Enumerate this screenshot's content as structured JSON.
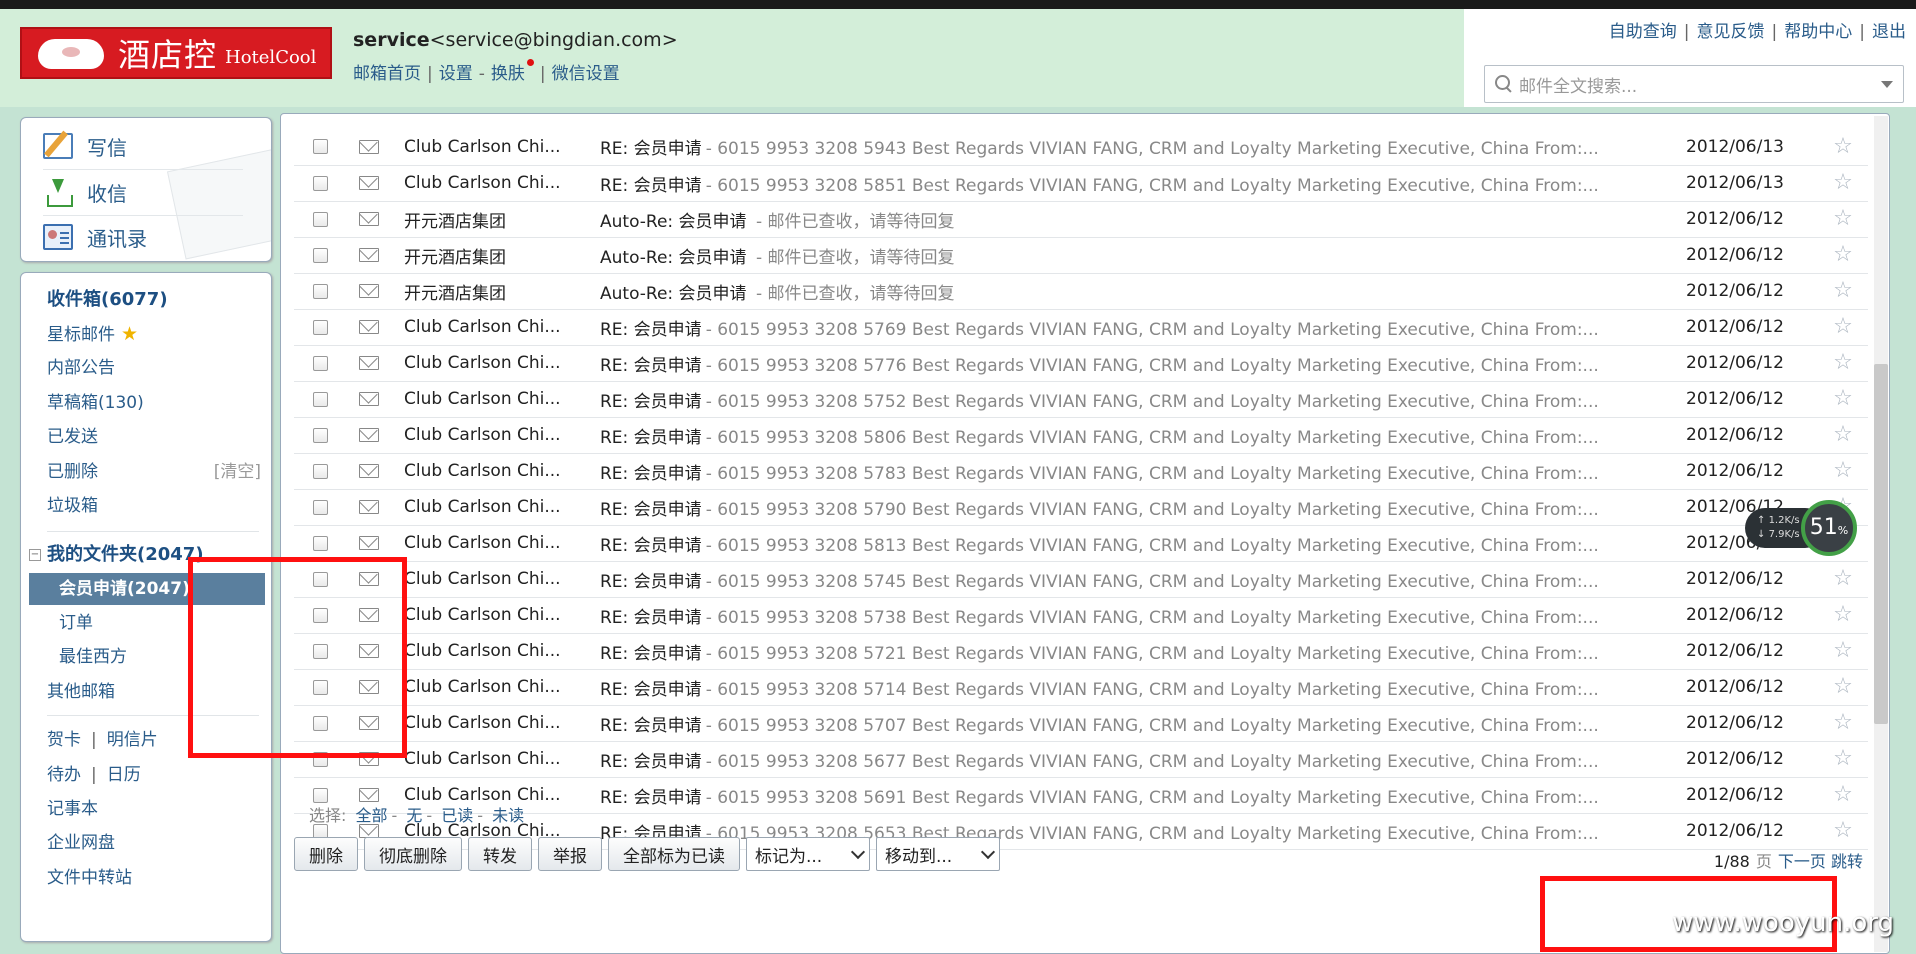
{
  "header": {
    "logo_cn": "酒店控",
    "logo_en": "HotelCool",
    "account_name": "service",
    "account_email": "<service@bingdian.com>",
    "links": [
      "邮箱首页",
      "设置",
      "换肤",
      "微信设置"
    ],
    "top_links": [
      "自助查询",
      "意见反馈",
      "帮助中心",
      "退出"
    ],
    "search_placeholder": "邮件全文搜索..."
  },
  "sidebar": {
    "quick": [
      "写信",
      "收信",
      "通讯录"
    ],
    "inbox": "收件箱(6077)",
    "starred": "星标邮件",
    "announce": "内部公告",
    "drafts": "草稿箱(130)",
    "sent": "已发送",
    "deleted": "已删除",
    "clear": "[清空]",
    "spam": "垃圾箱",
    "my_folders": "我的文件夹(2047)",
    "selected_folder": "会员申请(2047)",
    "subfolders": [
      "订单",
      "最佳西方"
    ],
    "other": "其他邮箱",
    "tools": [
      "贺卡",
      "明信片",
      "待办",
      "日历",
      "记事本",
      "企业网盘",
      "文件中转站"
    ]
  },
  "mails": [
    {
      "from": "Club Carlson Chi...",
      "subject": "RE: 会员申请",
      "summary": "- 6015 9953 3208 5943  Best Regards VIVIAN FANG, CRM and Loyalty Marketing Executive, China  From:...",
      "date": "2012/06/13"
    },
    {
      "from": "Club Carlson Chi...",
      "subject": "RE: 会员申请",
      "summary": "- 6015 9953 3208 5851  Best Regards VIVIAN FANG, CRM and Loyalty Marketing Executive, China  From:...",
      "date": "2012/06/13"
    },
    {
      "from": "开元酒店集团",
      "subject": "Auto-Re: 会员申请",
      "summary": " - 邮件已查收，请等待回复",
      "date": "2012/06/12"
    },
    {
      "from": "开元酒店集团",
      "subject": "Auto-Re: 会员申请",
      "summary": " - 邮件已查收，请等待回复",
      "date": "2012/06/12"
    },
    {
      "from": "开元酒店集团",
      "subject": "Auto-Re: 会员申请",
      "summary": " - 邮件已查收，请等待回复",
      "date": "2012/06/12"
    },
    {
      "from": "Club Carlson Chi...",
      "subject": "RE: 会员申请",
      "summary": "- 6015 9953 3208 5769  Best Regards VIVIAN FANG, CRM and Loyalty Marketing Executive, China  From:...",
      "date": "2012/06/12"
    },
    {
      "from": "Club Carlson Chi...",
      "subject": "RE: 会员申请",
      "summary": "- 6015 9953 3208 5776  Best Regards VIVIAN FANG, CRM and Loyalty Marketing Executive, China  From:...",
      "date": "2012/06/12"
    },
    {
      "from": "Club Carlson Chi...",
      "subject": "RE: 会员申请",
      "summary": "- 6015 9953 3208 5752  Best Regards VIVIAN FANG, CRM and Loyalty Marketing Executive, China  From:...",
      "date": "2012/06/12"
    },
    {
      "from": "Club Carlson Chi...",
      "subject": "RE: 会员申请",
      "summary": "- 6015 9953 3208 5806  Best Regards VIVIAN FANG, CRM and Loyalty Marketing Executive, China  From:...",
      "date": "2012/06/12"
    },
    {
      "from": "Club Carlson Chi...",
      "subject": "RE: 会员申请",
      "summary": "- 6015 9953 3208 5783  Best Regards VIVIAN FANG, CRM and Loyalty Marketing Executive, China  From:...",
      "date": "2012/06/12"
    },
    {
      "from": "Club Carlson Chi...",
      "subject": "RE: 会员申请",
      "summary": "- 6015 9953 3208 5790  Best Regards VIVIAN FANG, CRM and Loyalty Marketing Executive, China  From:...",
      "date": "2012/06/12"
    },
    {
      "from": "Club Carlson Chi...",
      "subject": "RE: 会员申请",
      "summary": "- 6015 9953 3208 5813  Best Regards VIVIAN FANG, CRM and Loyalty Marketing Executive, China  From:...",
      "date": "2012/06/12"
    },
    {
      "from": "Club Carlson Chi...",
      "subject": "RE: 会员申请",
      "summary": "- 6015 9953 3208 5745  Best Regards VIVIAN FANG, CRM and Loyalty Marketing Executive, China  From:...",
      "date": "2012/06/12"
    },
    {
      "from": "Club Carlson Chi...",
      "subject": "RE: 会员申请",
      "summary": "- 6015 9953 3208 5738  Best Regards VIVIAN FANG, CRM and Loyalty Marketing Executive, China  From:...",
      "date": "2012/06/12"
    },
    {
      "from": "Club Carlson Chi...",
      "subject": "RE: 会员申请",
      "summary": "- 6015 9953 3208 5721  Best Regards VIVIAN FANG, CRM and Loyalty Marketing Executive, China  From:...",
      "date": "2012/06/12"
    },
    {
      "from": "Club Carlson Chi...",
      "subject": "RE: 会员申请",
      "summary": "- 6015 9953 3208 5714  Best Regards VIVIAN FANG, CRM and Loyalty Marketing Executive, China  From:...",
      "date": "2012/06/12"
    },
    {
      "from": "Club Carlson Chi...",
      "subject": "RE: 会员申请",
      "summary": "- 6015 9953 3208 5707  Best Regards VIVIAN FANG, CRM and Loyalty Marketing Executive, China  From:...",
      "date": "2012/06/12"
    },
    {
      "from": "Club Carlson Chi...",
      "subject": "RE: 会员申请",
      "summary": "- 6015 9953 3208 5677  Best Regards VIVIAN FANG, CRM and Loyalty Marketing Executive, China  From:...",
      "date": "2012/06/12"
    },
    {
      "from": "Club Carlson Chi...",
      "subject": "RE: 会员申请",
      "summary": "- 6015 9953 3208 5691  Best Regards VIVIAN FANG, CRM and Loyalty Marketing Executive, China  From:...",
      "date": "2012/06/12"
    },
    {
      "from": "Club Carlson Chi...",
      "subject": "RE: 会员申请",
      "summary": "- 6015 9953 3208 5653  Best Regards VIVIAN FANG, CRM and Loyalty Marketing Executive, China  From:...",
      "date": "2012/06/12"
    }
  ],
  "select_bar": {
    "label": "选择:",
    "options": [
      "全部",
      "无",
      "已读",
      "未读"
    ]
  },
  "toolbar": {
    "buttons": [
      "删除",
      "彻底删除",
      "转发",
      "举报",
      "全部标为已读"
    ],
    "mark_as": "标记为...",
    "move_to": "移动到..."
  },
  "pager": {
    "page": "1/88",
    "unit": "页",
    "next": "下一页",
    "jump": "跳转"
  },
  "overlay": {
    "up_speed": "1.2K/s",
    "down_speed": "7.9K/s",
    "percent": "51",
    "percent_sign": "%",
    "watermark": "www.wooyun.org"
  }
}
